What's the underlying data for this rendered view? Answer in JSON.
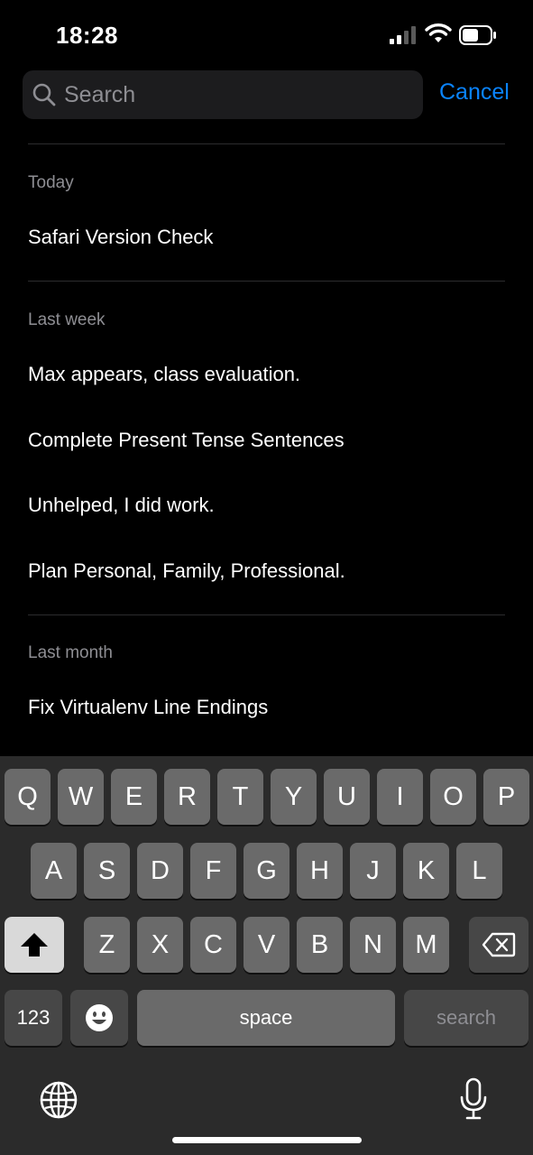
{
  "status_bar": {
    "time": "18:28"
  },
  "search": {
    "placeholder": "Search",
    "value": "",
    "cancel_label": "Cancel"
  },
  "sections": [
    {
      "header": "Today",
      "items": [
        "Safari Version Check"
      ]
    },
    {
      "header": "Last week",
      "items": [
        "Max appears, class evaluation.",
        "Complete Present Tense Sentences",
        "Unhelped, I did work.",
        "Plan Personal, Family, Professional."
      ]
    },
    {
      "header": "Last month",
      "items": [
        "Fix Virtualenv Line Endings"
      ]
    }
  ],
  "keyboard": {
    "row1": [
      "Q",
      "W",
      "E",
      "R",
      "T",
      "Y",
      "U",
      "I",
      "O",
      "P"
    ],
    "row2": [
      "A",
      "S",
      "D",
      "F",
      "G",
      "H",
      "J",
      "K",
      "L"
    ],
    "row3": [
      "Z",
      "X",
      "C",
      "V",
      "B",
      "N",
      "M"
    ],
    "numbers_label": "123",
    "space_label": "space",
    "search_label": "search",
    "icons": [
      "shift-icon",
      "delete-icon",
      "emoji-icon",
      "globe-icon",
      "microphone-icon"
    ]
  },
  "colors": {
    "accent": "#0a84ff",
    "background": "#000000",
    "key": "#6a6a6a",
    "key_dark": "#474747"
  }
}
